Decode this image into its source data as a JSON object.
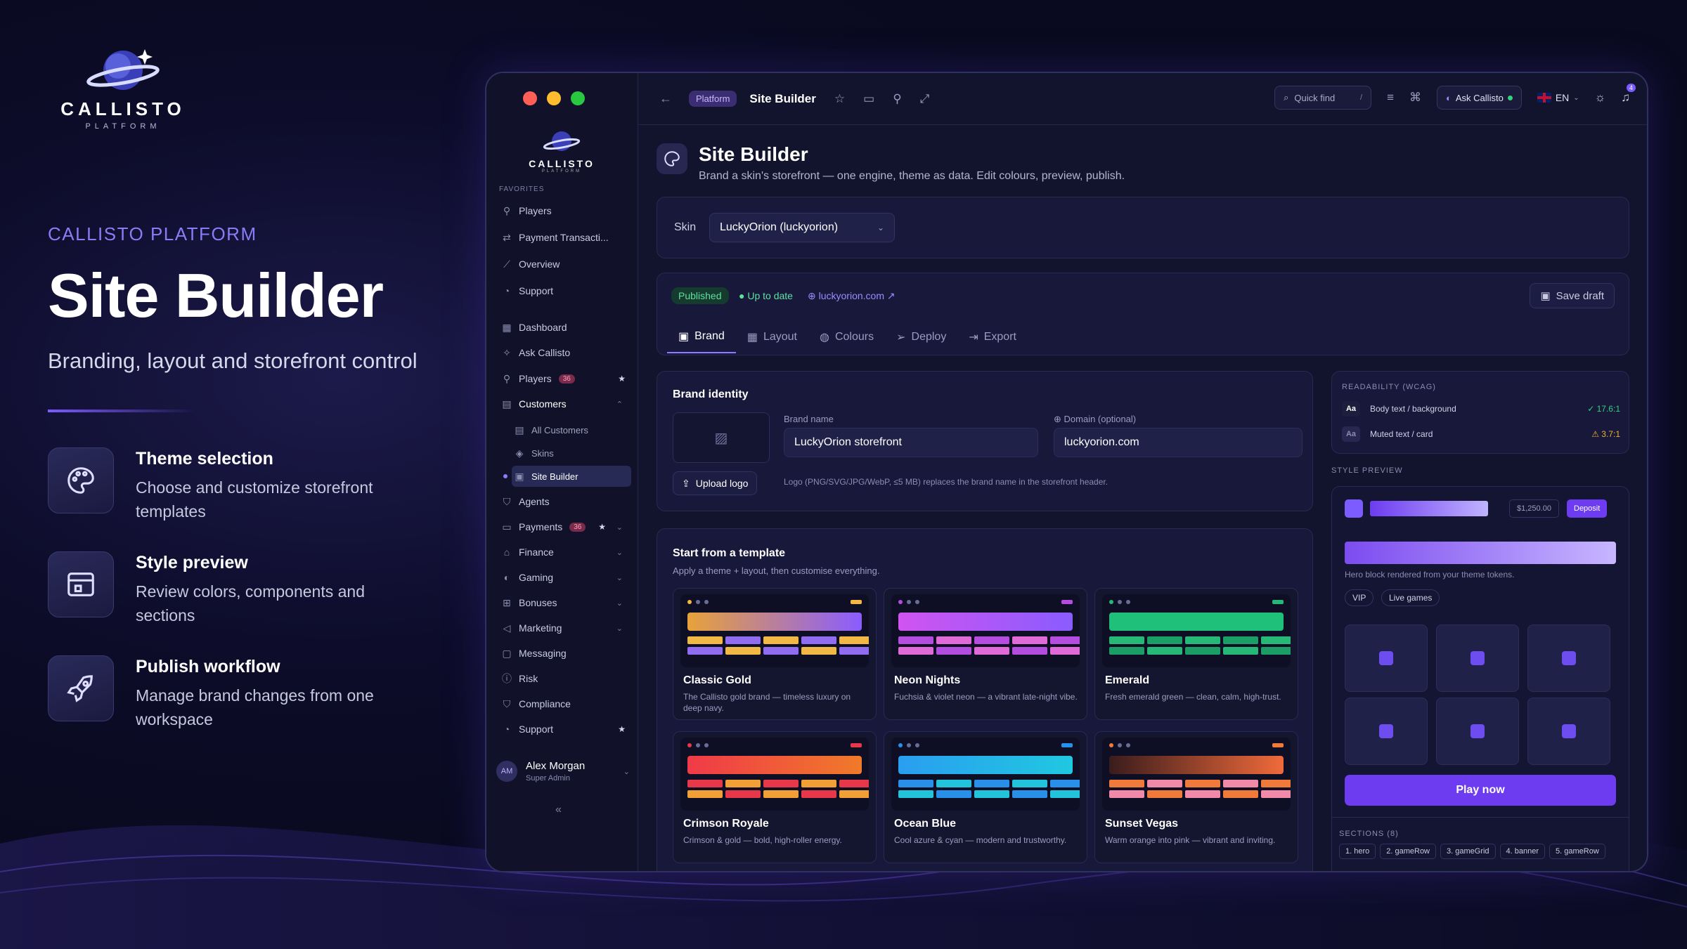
{
  "hero": {
    "logo_word": "CALLISTO",
    "logo_sub": "PLATFORM",
    "eyebrow": "CALLISTO PLATFORM",
    "title": "Site Builder",
    "lead": "Branding, layout and storefront control",
    "features": [
      {
        "icon": "palette-icon",
        "title": "Theme selection",
        "desc": "Choose and customize storefront templates"
      },
      {
        "icon": "layout-icon",
        "title": "Style preview",
        "desc": "Review colors, components and sections"
      },
      {
        "icon": "rocket-icon",
        "title": "Publish workflow",
        "desc": "Manage brand changes from one workspace"
      }
    ]
  },
  "sidebar": {
    "logo_word": "CALLISTO",
    "logo_sub": "PLATFORM",
    "favorites_label": "FAVORITES",
    "favorites": [
      {
        "icon": "user-icon",
        "label": "Players"
      },
      {
        "icon": "transfer-icon",
        "label": "Payment Transacti..."
      },
      {
        "icon": "chart-icon",
        "label": "Overview"
      },
      {
        "icon": "headset-icon",
        "label": "Support"
      }
    ],
    "nav": {
      "dashboard": "Dashboard",
      "ask": "Ask Callisto",
      "players": "Players",
      "players_badge": "36",
      "customers": "Customers",
      "all_customers": "All Customers",
      "skins": "Skins",
      "site_builder": "Site Builder",
      "agents": "Agents",
      "payments": "Payments",
      "payments_badge": "36",
      "finance": "Finance",
      "gaming": "Gaming",
      "bonuses": "Bonuses",
      "marketing": "Marketing",
      "messaging": "Messaging",
      "risk": "Risk",
      "compliance": "Compliance",
      "support": "Support"
    },
    "user": {
      "initials": "AM",
      "name": "Alex Morgan",
      "role": "Super Admin"
    },
    "collapse": "«"
  },
  "topbar": {
    "crumb": "Platform",
    "title": "Site Builder",
    "quick_find": "Quick find",
    "quick_key": "/",
    "ask": "Ask Callisto",
    "lang": "EN",
    "notif_count": "4"
  },
  "page": {
    "title": "Site Builder",
    "subtitle": "Brand a skin's storefront — one engine, theme as data. Edit colours, preview, publish."
  },
  "skin": {
    "label": "Skin",
    "value": "LuckyOrion (luckyorion)"
  },
  "status": {
    "published": "Published",
    "uptodate": "Up to date",
    "domain": "luckyorion.com",
    "save": "Save draft"
  },
  "tabs": [
    "Brand",
    "Layout",
    "Colours",
    "Deploy",
    "Export"
  ],
  "brand": {
    "heading": "Brand identity",
    "name_label": "Brand name",
    "name_value": "LuckyOrion storefront",
    "domain_label": "Domain (optional)",
    "domain_value": "luckyorion.com",
    "upload": "Upload logo",
    "hint": "Logo (PNG/SVG/JPG/WebP, ≤5 MB) replaces the brand name in the storefront header."
  },
  "templates": {
    "heading": "Start from a template",
    "sub": "Apply a theme + layout, then customise everything.",
    "items": [
      {
        "name": "Classic Gold",
        "desc": "The Callisto gold brand — timeless luxury on deep navy.",
        "bar": "#e8a23a",
        "bar2": "#8a5cff",
        "c1": "#f2b845",
        "c2": "#8f6cf0"
      },
      {
        "name": "Neon Nights",
        "desc": "Fuchsia & violet neon — a vibrant late-night vibe.",
        "bar": "#d054f0",
        "bar2": "#8a5cff",
        "c1": "#b44ce0",
        "c2": "#e06ad8"
      },
      {
        "name": "Emerald",
        "desc": "Fresh emerald green — clean, calm, high-trust.",
        "bar": "#1fc07a",
        "bar2": "#1fc07a",
        "c1": "#25b877",
        "c2": "#1a9e66"
      },
      {
        "name": "Crimson Royale",
        "desc": "Crimson & gold — bold, high-roller energy.",
        "bar": "#f03a48",
        "bar2": "#f07a2a",
        "c1": "#e63848",
        "c2": "#f2a035"
      },
      {
        "name": "Ocean Blue",
        "desc": "Cool azure & cyan — modern and trustworthy.",
        "bar": "#2a9ef0",
        "bar2": "#20c8e0",
        "c1": "#2890e8",
        "c2": "#22c4dc"
      },
      {
        "name": "Sunset Vegas",
        "desc": "Warm orange into pink — vibrant and inviting.",
        "bar": "#3a1c1c",
        "bar2": "#f06a3a",
        "c1": "#f07a3a",
        "c2": "#f08aa8"
      }
    ]
  },
  "readability": {
    "heading": "READABILITY (WCAG)",
    "rows": [
      {
        "aa": "Aa",
        "label": "Body text / background",
        "ratio": "17.6:1",
        "ok": "#35d07f"
      },
      {
        "aa": "Aa",
        "label": "Muted text / card",
        "ratio": "3.7:1",
        "ok": "#f0b030"
      }
    ]
  },
  "preview": {
    "heading": "STYLE PREVIEW",
    "amount": "$1,250.00",
    "deposit": "Deposit",
    "hero_caption": "Hero block rendered from your theme tokens.",
    "chips": [
      "VIP",
      "Live games"
    ],
    "play": "Play now"
  },
  "sections": {
    "heading": "SECTIONS (8)",
    "items": [
      "1. hero",
      "2. gameRow",
      "3. gameGrid",
      "4. banner",
      "5. gameRow"
    ]
  }
}
